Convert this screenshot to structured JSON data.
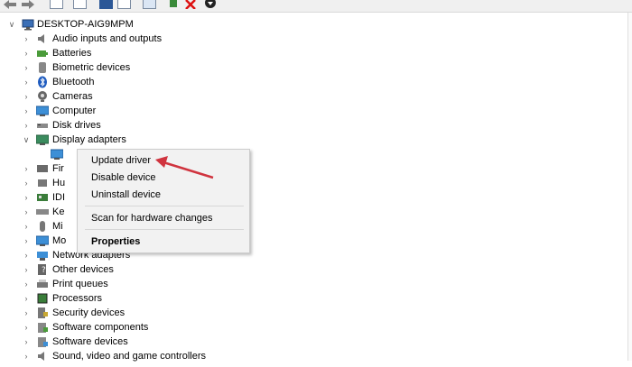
{
  "toolbar": {
    "buttons": [
      "back-icon",
      "forward-icon",
      "properties-icon",
      "refresh-icon",
      "help-icon",
      "monitor-icon",
      "update-driver-icon",
      "uninstall-icon",
      "download-icon"
    ]
  },
  "tree": {
    "root": "DESKTOP-AIG9MPM",
    "items": [
      {
        "label": "Audio inputs and outputs",
        "icon": "speaker-icon"
      },
      {
        "label": "Batteries",
        "icon": "battery-icon"
      },
      {
        "label": "Biometric devices",
        "icon": "fingerprint-icon"
      },
      {
        "label": "Bluetooth",
        "icon": "bluetooth-icon"
      },
      {
        "label": "Cameras",
        "icon": "camera-icon"
      },
      {
        "label": "Computer",
        "icon": "computer-icon"
      },
      {
        "label": "Disk drives",
        "icon": "disk-drive-icon"
      },
      {
        "label": "Display adapters",
        "icon": "display-adapter-icon",
        "expanded": true
      },
      {
        "label": "",
        "icon": "display-adapter-child-icon",
        "child": true
      },
      {
        "label": "Fir",
        "icon": "firmware-icon"
      },
      {
        "label": "Hu",
        "icon": "hid-icon"
      },
      {
        "label": "IDI",
        "icon": "ide-controller-icon"
      },
      {
        "label": "Ke",
        "icon": "keyboard-icon"
      },
      {
        "label": "Mi",
        "icon": "mouse-icon"
      },
      {
        "label": "Mo",
        "icon": "monitor-icon"
      },
      {
        "label": "Network adapters",
        "icon": "network-icon"
      },
      {
        "label": "Other devices",
        "icon": "other-devices-icon"
      },
      {
        "label": "Print queues",
        "icon": "printer-icon"
      },
      {
        "label": "Processors",
        "icon": "processor-icon"
      },
      {
        "label": "Security devices",
        "icon": "security-icon"
      },
      {
        "label": "Software components",
        "icon": "software-component-icon"
      },
      {
        "label": "Software devices",
        "icon": "software-device-icon"
      },
      {
        "label": "Sound, video and game controllers",
        "icon": "sound-icon"
      }
    ]
  },
  "context_menu": {
    "update": "Update driver",
    "disable": "Disable device",
    "uninstall": "Uninstall device",
    "scan": "Scan for hardware changes",
    "properties": "Properties"
  },
  "colors": {
    "arrow": "#d0343f",
    "menu_bg": "#f2f2f2",
    "tree_bg": "#ffffff"
  }
}
